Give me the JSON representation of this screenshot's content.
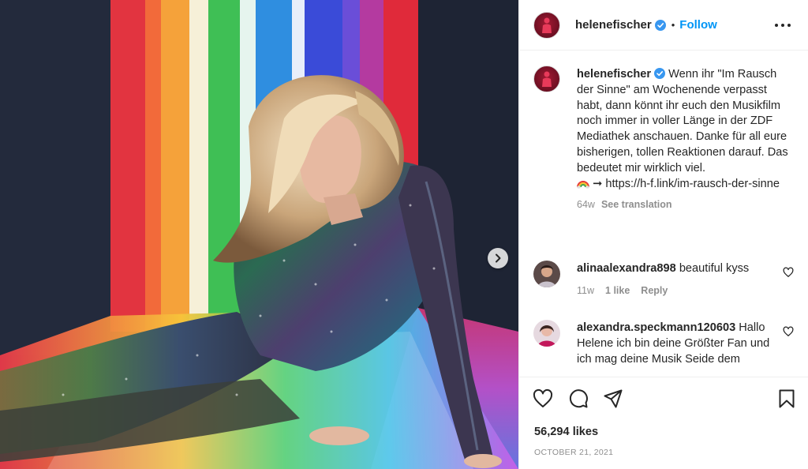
{
  "post": {
    "username": "helenefischer",
    "follow_label": "Follow",
    "separator": "•",
    "more_icon": "more-options-icon",
    "next_icon": "chevron-right-icon"
  },
  "caption": {
    "username": "helenefischer",
    "text": "Wenn ihr \"Im Rausch der Sinne\" am Wochenende verpasst habt, dann könnt ihr euch den Musikfilm noch immer in voller Länge in der ZDF Mediathek anschauen. Danke für all eure bisherigen, tollen Reaktionen darauf. Das bedeutet mir wirklich viel.",
    "arrow": "➞",
    "link": "https://h-f.link/im-rausch-der-sinne",
    "age": "64w",
    "translate_label": "See translation"
  },
  "comments": [
    {
      "username": "alinaalexandra898",
      "text": "beautiful kyss",
      "age": "11w",
      "likes": "1 like",
      "reply_label": "Reply"
    },
    {
      "username": "alexandra.speckmann120603",
      "text": "Hallo Helene ich bin deine Größter Fan und ich mag deine Musik Seide dem",
      "age": "",
      "likes": "",
      "reply_label": ""
    }
  ],
  "actions": {
    "like_icon": "heart-icon",
    "comment_icon": "comment-icon",
    "share_icon": "share-icon",
    "save_icon": "bookmark-icon"
  },
  "likes_count": "56,294 likes",
  "date": "OCTOBER 21, 2021",
  "colors": {
    "accent": "#0095f6",
    "verified": "#3897f0",
    "text": "#262626",
    "muted": "#8e8e8e"
  }
}
